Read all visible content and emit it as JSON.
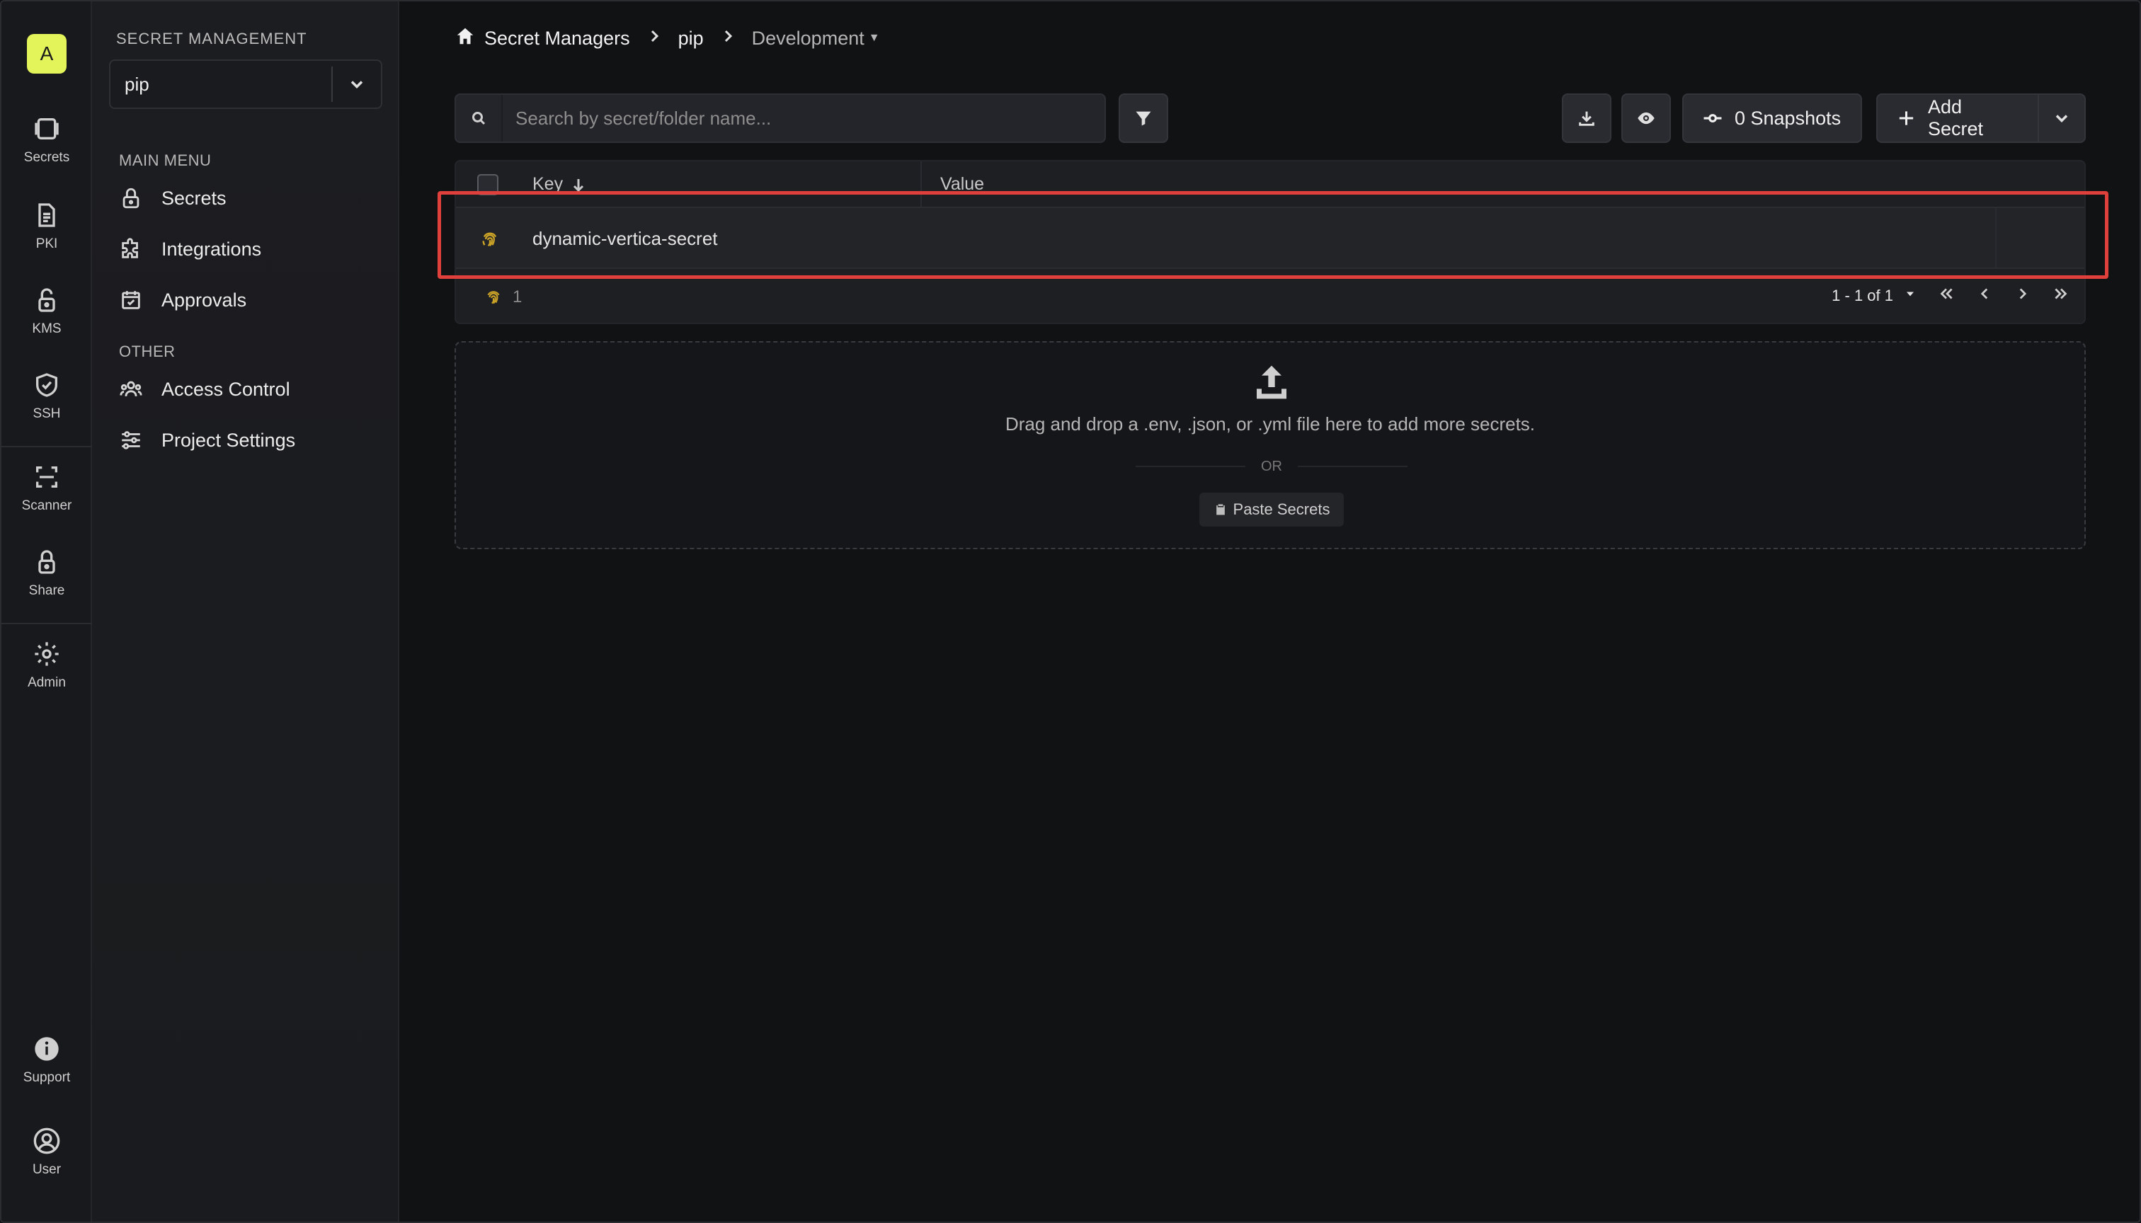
{
  "org": {
    "avatar_letter": "A"
  },
  "rail": {
    "items": [
      {
        "label": "Secrets",
        "icon": "vault-icon"
      },
      {
        "label": "PKI",
        "icon": "document-icon"
      },
      {
        "label": "KMS",
        "icon": "lock-open-icon"
      },
      {
        "label": "SSH",
        "icon": "shield-icon"
      },
      {
        "label": "Scanner",
        "icon": "scan-icon"
      },
      {
        "label": "Share",
        "icon": "lock-icon"
      },
      {
        "label": "Admin",
        "icon": "gear-icon"
      },
      {
        "label": "Support",
        "icon": "info-icon"
      },
      {
        "label": "User",
        "icon": "user-circle-icon"
      }
    ]
  },
  "sidebar": {
    "heading": "SECRET MANAGEMENT",
    "project_select": {
      "value": "pip"
    },
    "main_menu_label": "MAIN MENU",
    "main_menu": [
      {
        "label": "Secrets",
        "icon": "lock-icon"
      },
      {
        "label": "Integrations",
        "icon": "puzzle-icon"
      },
      {
        "label": "Approvals",
        "icon": "calendar-check-icon"
      }
    ],
    "other_label": "OTHER",
    "other": [
      {
        "label": "Access Control",
        "icon": "users-icon"
      },
      {
        "label": "Project Settings",
        "icon": "sliders-icon"
      }
    ]
  },
  "breadcrumb": {
    "root": "Secret Managers",
    "project": "pip",
    "environment": "Development"
  },
  "toolbar": {
    "search_placeholder": "Search by secret/folder name...",
    "snapshots_label": "0 Snapshots",
    "add_secret_label": "Add Secret"
  },
  "table": {
    "columns": {
      "key": "Key",
      "value": "Value"
    },
    "rows": [
      {
        "key": "dynamic-vertica-secret",
        "icon": "fingerprint-icon"
      }
    ],
    "footer_count": "1",
    "pagination": "1 - 1 of 1"
  },
  "dropzone": {
    "text": "Drag and drop a .env, .json, or .yml file here to add more secrets.",
    "or": "OR",
    "paste_label": "Paste Secrets"
  },
  "colors": {
    "accent": "#e3f35a",
    "highlight": "#e0403c",
    "dynamic_secret_icon": "#c9a227"
  }
}
